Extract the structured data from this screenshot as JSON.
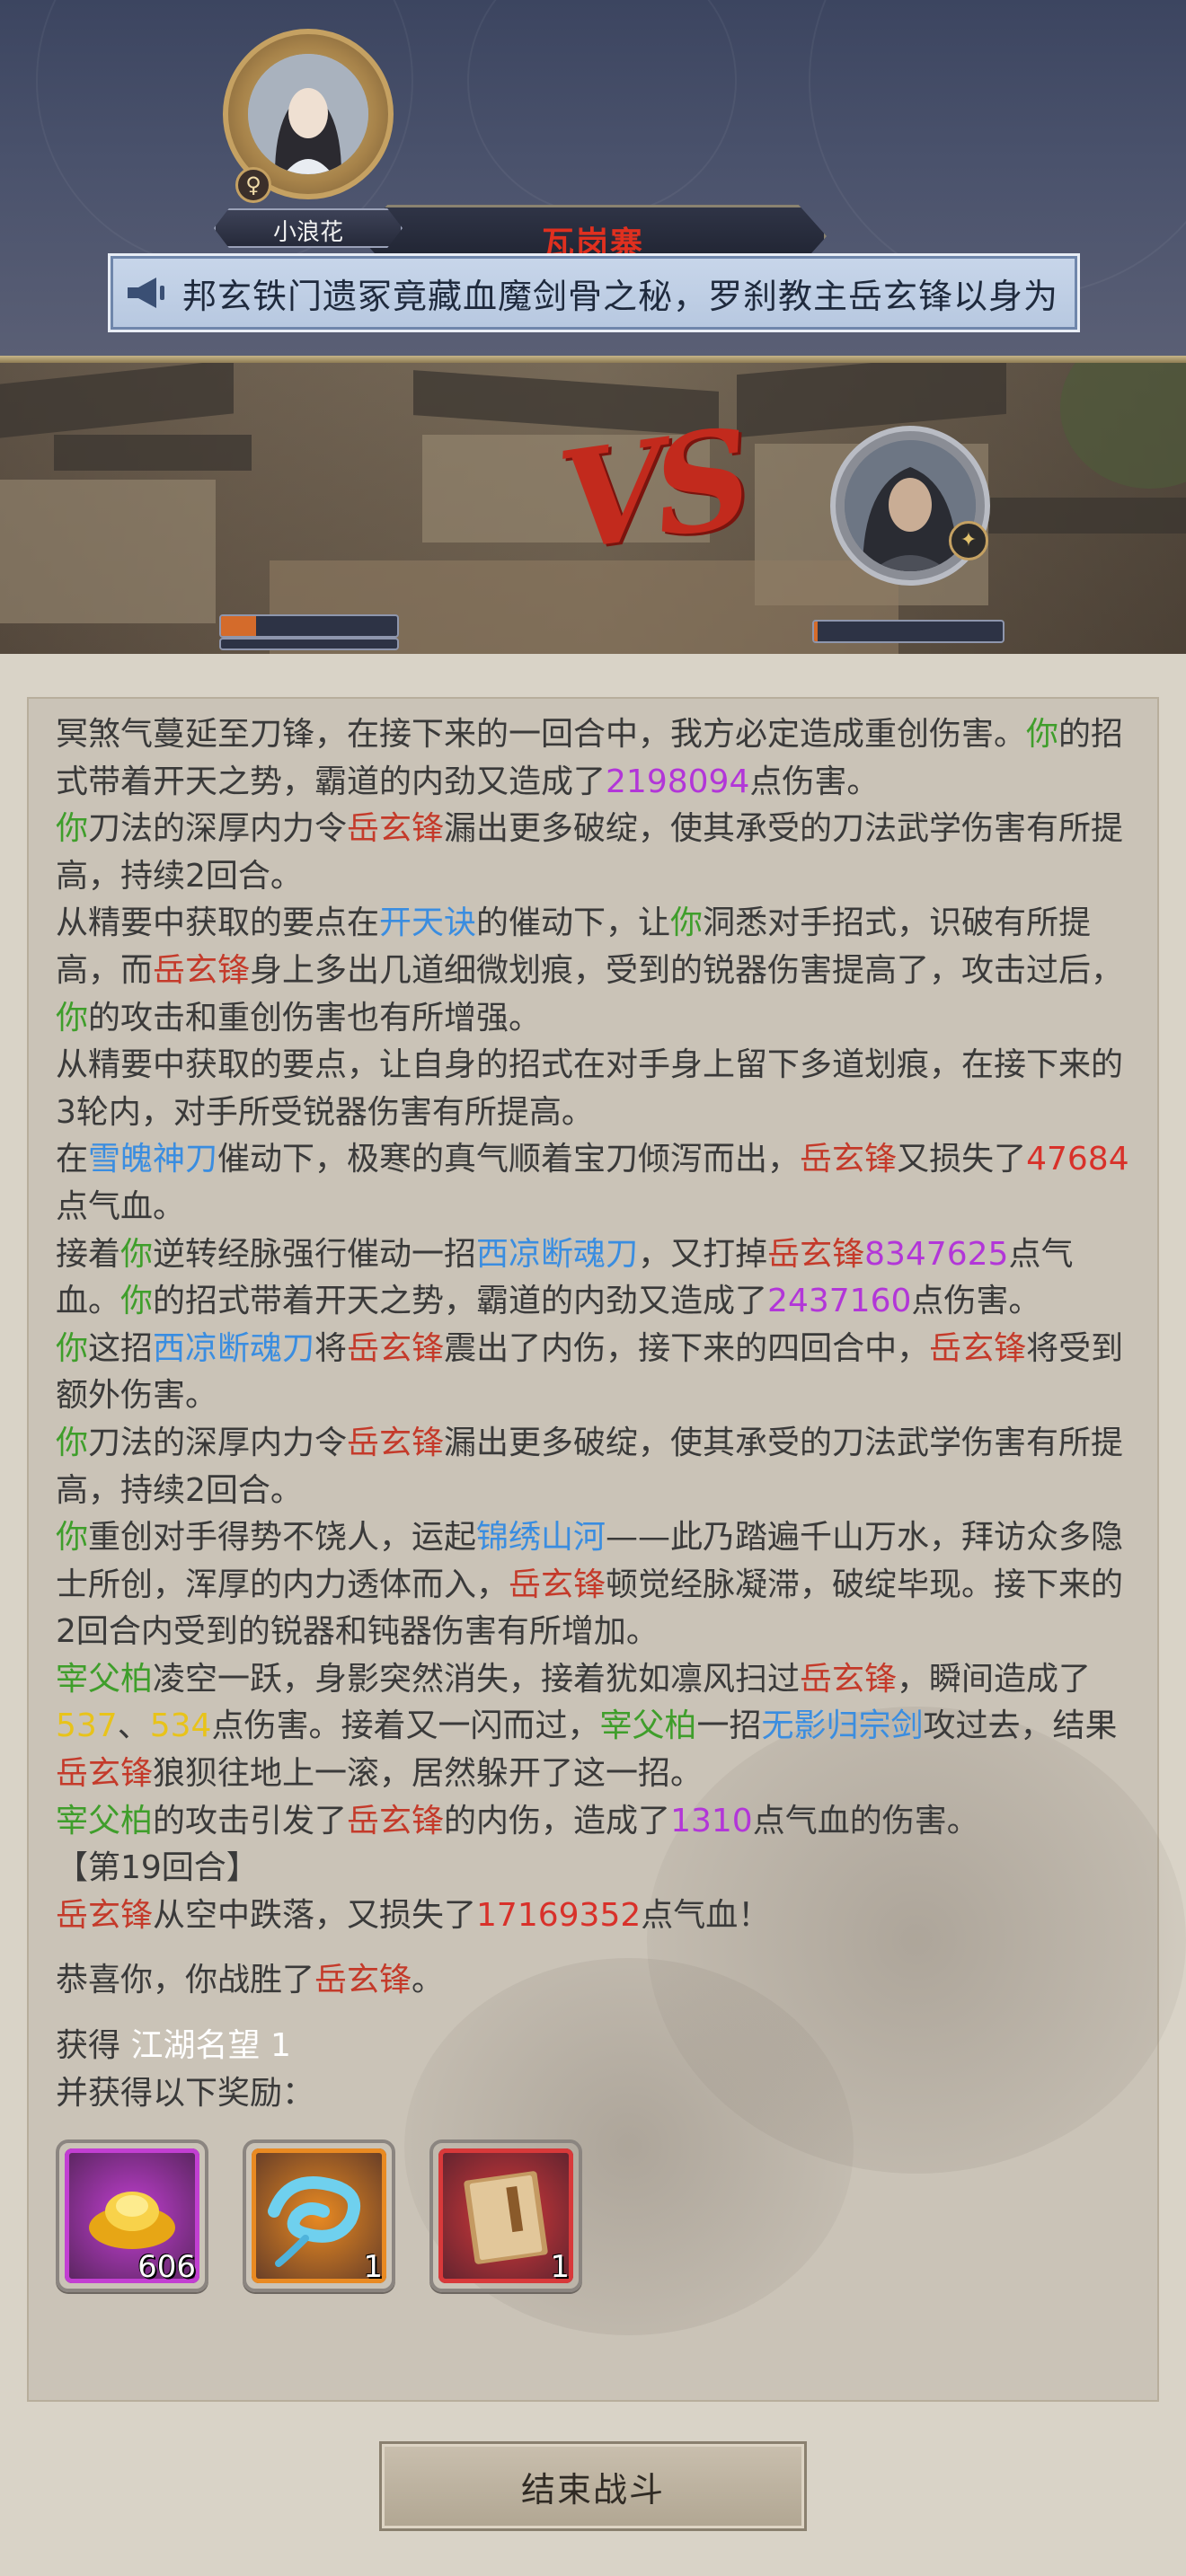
{
  "header": {
    "title": "瓦岗寨",
    "announcement": "邦玄铁门遗冢竟藏血魔剑骨之秘，罗刹教主岳玄锋以身为"
  },
  "battle": {
    "player": {
      "name": "小浪花",
      "gender_icon": "female-symbol",
      "hp_fraction": 0.2
    },
    "enemy": {
      "hp_fraction": 0.02
    },
    "vs_label": "VS"
  },
  "log": [
    [
      [
        "冥煞气蔓延至刀锋，在接下来的一回合中，我方必定造成重创伤害。",
        ""
      ],
      [
        "你",
        "green"
      ],
      [
        "的招式带着开天之势，霸道的内劲又造成了",
        ""
      ],
      [
        "2198094",
        "purple"
      ],
      [
        "点伤害。",
        ""
      ]
    ],
    [
      [
        "你",
        "green"
      ],
      [
        "刀法的深厚内力令",
        ""
      ],
      [
        "岳玄锋",
        "red"
      ],
      [
        "漏出更多破绽，使其承受的刀法武学伤害有所提高，持续2回合。",
        ""
      ]
    ],
    [
      [
        "从精要中获取的要点在",
        ""
      ],
      [
        "开天诀",
        "blue"
      ],
      [
        "的催动下，让",
        ""
      ],
      [
        "你",
        "green"
      ],
      [
        "洞悉对手招式，识破有所提高，而",
        ""
      ],
      [
        "岳玄锋",
        "red"
      ],
      [
        "身上多出几道细微划痕，受到的锐器伤害提高了，攻击过后，",
        ""
      ],
      [
        "你",
        "green"
      ],
      [
        "的攻击和重创伤害也有所增强。",
        ""
      ]
    ],
    [
      [
        "从精要中获取的要点，让自身的招式在对手身上留下多道划痕，在接下来的3轮内，对手所受锐器伤害有所提高。",
        ""
      ]
    ],
    [
      [
        "在",
        ""
      ],
      [
        "雪魄神刀",
        "blue"
      ],
      [
        "催动下，极寒的真气顺着宝刀倾泻而出，",
        ""
      ],
      [
        "岳玄锋",
        "red"
      ],
      [
        "又损失了",
        ""
      ],
      [
        "47684",
        "crit"
      ],
      [
        "点气血。",
        ""
      ]
    ],
    [
      [
        "接着",
        ""
      ],
      [
        "你",
        "green"
      ],
      [
        "逆转经脉强行催动一招",
        ""
      ],
      [
        "西凉断魂刀",
        "blue"
      ],
      [
        "，又打掉",
        ""
      ],
      [
        "岳玄锋",
        "red"
      ],
      [
        "8347625",
        "purple"
      ],
      [
        "点气血。",
        ""
      ],
      [
        "你",
        "green"
      ],
      [
        "的招式带着开天之势，霸道的内劲又造成了",
        ""
      ],
      [
        "2437160",
        "purple"
      ],
      [
        "点伤害。",
        ""
      ]
    ],
    [
      [
        "你",
        "green"
      ],
      [
        "这招",
        ""
      ],
      [
        "西凉断魂刀",
        "blue"
      ],
      [
        "将",
        ""
      ],
      [
        "岳玄锋",
        "red"
      ],
      [
        "震出了内伤，接下来的四回合中，",
        ""
      ],
      [
        "岳玄锋",
        "red"
      ],
      [
        "将受到额外伤害。",
        ""
      ]
    ],
    [
      [
        "你",
        "green"
      ],
      [
        "刀法的深厚内力令",
        ""
      ],
      [
        "岳玄锋",
        "red"
      ],
      [
        "漏出更多破绽，使其承受的刀法武学伤害有所提高，持续2回合。",
        ""
      ]
    ],
    [
      [
        "你",
        "green"
      ],
      [
        "重创对手得势不饶人，运起",
        ""
      ],
      [
        "锦绣山河",
        "blue"
      ],
      [
        "——此乃踏遍千山万水，拜访众多隐士所创，浑厚的内力透体而入，",
        ""
      ],
      [
        "岳玄锋",
        "red"
      ],
      [
        "顿觉经脉凝滞，破绽毕现。接下来的2回合内受到的锐器和钝器伤害有所增加。",
        ""
      ]
    ],
    [
      [
        "宰父柏",
        "green"
      ],
      [
        "凌空一跃，身影突然消失，接着犹如凛风扫过",
        ""
      ],
      [
        "岳玄锋",
        "red"
      ],
      [
        "，瞬间造成了",
        ""
      ],
      [
        "537",
        "yellow"
      ],
      [
        "、",
        ""
      ],
      [
        "534",
        "yellow"
      ],
      [
        "点伤害。接着又一闪而过，",
        ""
      ],
      [
        "宰父柏",
        "green"
      ],
      [
        "一招",
        ""
      ],
      [
        "无影归宗剑",
        "blue"
      ],
      [
        "攻过去，结果",
        ""
      ],
      [
        "岳玄锋",
        "red"
      ],
      [
        "狼狈往地上一滚，居然躲开了这一招。",
        ""
      ]
    ],
    [
      [
        "宰父柏",
        "green"
      ],
      [
        "的攻击引发了",
        ""
      ],
      [
        "岳玄锋",
        "red"
      ],
      [
        "的内伤，造成了",
        ""
      ],
      [
        "1310",
        "purple"
      ],
      [
        "点气血的伤害。",
        ""
      ]
    ]
  ],
  "round_label": "【第19回合】",
  "round_lines": [
    [
      [
        "岳玄锋",
        "red"
      ],
      [
        "从空中跌落，又损失了",
        ""
      ],
      [
        "17169352",
        "crit"
      ],
      [
        "点气血！",
        ""
      ]
    ]
  ],
  "victory": [
    [
      "恭喜你，你战胜了",
      ""
    ],
    [
      "岳玄锋",
      "red"
    ],
    [
      "。",
      ""
    ]
  ],
  "fame": {
    "label": "获得",
    "name": "江湖名望",
    "value": "1"
  },
  "rewards_label": "并获得以下奖励：",
  "rewards": [
    {
      "icon": "gold-ingot-icon",
      "count": "606",
      "frame": "#c23fd2"
    },
    {
      "icon": "blue-cloud-icon",
      "count": "1",
      "frame": "#e98a22"
    },
    {
      "icon": "manual-book-icon",
      "count": "1",
      "frame": "#d8393a"
    }
  ],
  "end_button": "结束战斗",
  "colors": {
    "green": "#3f9e2b",
    "red": "#c43a2a",
    "purple": "#b236d8",
    "blue": "#3a8de0",
    "yellow": "#e8c31a",
    "crit": "#d8312a"
  }
}
